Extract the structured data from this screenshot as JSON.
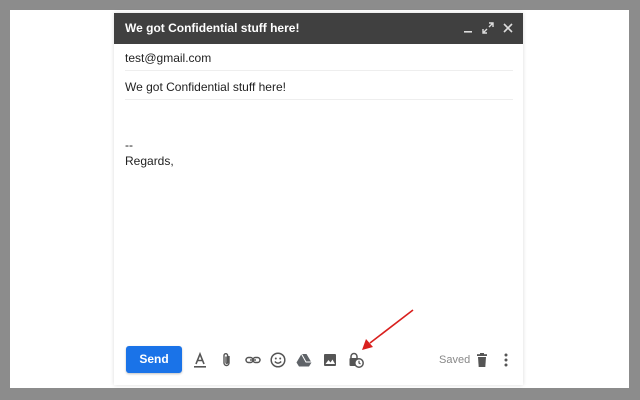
{
  "compose": {
    "title": "We got Confidential stuff here!",
    "to": "test@gmail.com",
    "subject": "We got Confidential stuff here!",
    "body_line1": "--",
    "body_line2": "Regards,"
  },
  "toolbar": {
    "send_label": "Send",
    "status": "Saved"
  },
  "icons": [
    "minimize-icon",
    "popout-icon",
    "close-icon",
    "formatting-icon",
    "attach-icon",
    "link-icon",
    "emoji-icon",
    "drive-icon",
    "photo-icon",
    "confidential-mode-icon",
    "trash-icon",
    "more-options-icon"
  ],
  "colors": {
    "titlebar": "#404040",
    "send": "#1a73e8",
    "annotation_arrow": "#d9201e",
    "backdrop": "#8c8c8c"
  }
}
